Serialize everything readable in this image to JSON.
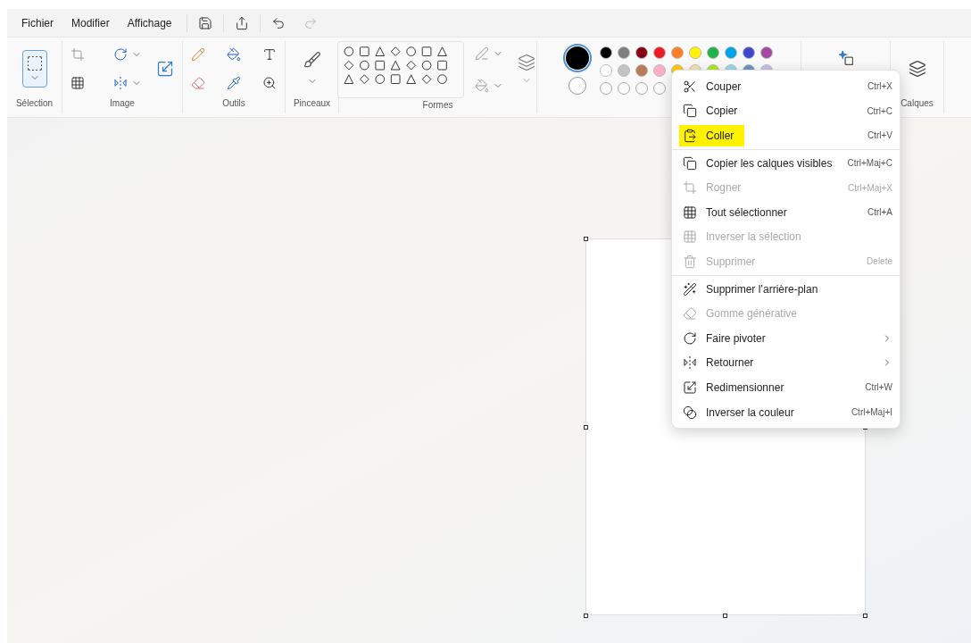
{
  "menu_bar": {
    "items": [
      {
        "label": "Fichier"
      },
      {
        "label": "Modifier"
      },
      {
        "label": "Affichage"
      }
    ],
    "redo_disabled": true
  },
  "ribbon": {
    "groups": [
      {
        "kind": "selection",
        "label": "Sélection"
      },
      {
        "kind": "image",
        "label": "Image"
      },
      {
        "kind": "tools",
        "label": "Outils"
      },
      {
        "kind": "brushes",
        "label": "Pinceaux"
      },
      {
        "kind": "shapes",
        "label": "Formes"
      },
      {
        "kind": "colors"
      },
      {
        "kind": "ai"
      },
      {
        "kind": "layers",
        "label": "Calques"
      }
    ],
    "palette": [
      {
        "color": "#000000"
      },
      {
        "color": "#7f7f7f"
      },
      {
        "color": "#880015"
      },
      {
        "color": "#ed1c24"
      },
      {
        "color": "#ff7f27"
      },
      {
        "color": "#fff200"
      },
      {
        "color": "#22b14c"
      },
      {
        "color": "#00a2e8"
      },
      {
        "color": "#3f48cc"
      },
      {
        "color": "#a349a4"
      },
      {
        "color": "#ffffff"
      },
      {
        "color": "#c3c3c3"
      },
      {
        "color": "#b97a57"
      },
      {
        "color": "#ffaec9"
      },
      {
        "color": "#ffc90e"
      },
      {
        "color": "#efe4b0"
      },
      {
        "color": "#b5e61d"
      },
      {
        "color": "#99d9ea"
      },
      {
        "color": "#7092be"
      },
      {
        "color": "#c8bfe7"
      }
    ]
  },
  "context_menu": {
    "items": [
      {
        "kind": "cut",
        "label": "Couper",
        "shortcut": "Ctrl+X",
        "disabled": false,
        "highlighted": false
      },
      {
        "kind": "copy",
        "label": "Copier",
        "shortcut": "Ctrl+C",
        "disabled": false,
        "highlighted": false
      },
      {
        "kind": "paste",
        "label": "Coller",
        "shortcut": "Ctrl+V",
        "disabled": false,
        "highlighted": true
      },
      {
        "kind": "separator"
      },
      {
        "kind": "copy_layers",
        "label": "Copier les calques visibles",
        "shortcut": "Ctrl+Maj+C",
        "disabled": false,
        "highlighted": false
      },
      {
        "kind": "crop",
        "label": "Rogner",
        "shortcut": "Ctrl+Maj+X",
        "disabled": true,
        "highlighted": false
      },
      {
        "kind": "select_all",
        "label": "Tout sélectionner",
        "shortcut": "Ctrl+A",
        "disabled": false,
        "highlighted": false
      },
      {
        "kind": "invert_selection",
        "label": "Inverser la sélection",
        "disabled": true,
        "highlighted": false
      },
      {
        "kind": "delete",
        "label": "Supprimer",
        "shortcut": "Delete",
        "disabled": true,
        "highlighted": false
      },
      {
        "kind": "separator"
      },
      {
        "kind": "remove_bg",
        "label": "Supprimer l’arrière-plan",
        "disabled": false,
        "highlighted": false
      },
      {
        "kind": "gen_erase",
        "label": "Gomme générative",
        "disabled": true,
        "highlighted": false
      },
      {
        "kind": "rotate",
        "label": "Faire pivoter",
        "submenu": true,
        "disabled": false,
        "highlighted": false
      },
      {
        "kind": "flip",
        "label": "Retourner",
        "submenu": true,
        "disabled": false,
        "highlighted": false
      },
      {
        "kind": "resize",
        "label": "Redimensionner",
        "shortcut": "Ctrl+W",
        "disabled": false,
        "highlighted": false
      },
      {
        "kind": "invert_color",
        "label": "Inverser la couleur",
        "shortcut": "Ctrl+Maj+I",
        "disabled": false,
        "highlighted": false
      }
    ]
  }
}
